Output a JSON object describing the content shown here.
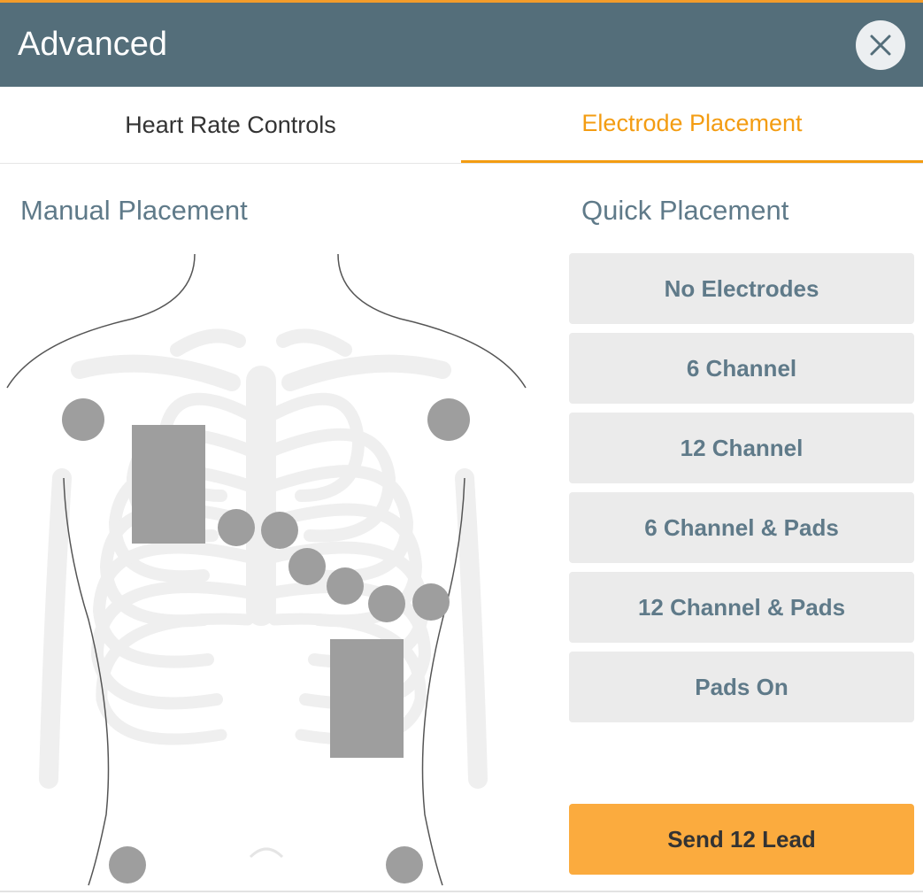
{
  "header": {
    "title": "Advanced",
    "close_icon": "close-icon"
  },
  "tabs": [
    {
      "label": "Heart Rate Controls",
      "active": false
    },
    {
      "label": "Electrode Placement",
      "active": true
    }
  ],
  "manual_placement": {
    "title": "Manual Placement"
  },
  "quick_placement": {
    "title": "Quick Placement",
    "options": [
      {
        "label": "No Electrodes"
      },
      {
        "label": "6 Channel"
      },
      {
        "label": "12 Channel"
      },
      {
        "label": "6 Channel & Pads"
      },
      {
        "label": "12 Channel & Pads"
      },
      {
        "label": "Pads On"
      }
    ]
  },
  "send_button": {
    "label": "Send 12 Lead"
  },
  "colors": {
    "header": "#546e7a",
    "accent": "#f39c12",
    "send": "#fbab3e",
    "electrode": "#9e9e9e",
    "section_title": "#5f7a89"
  }
}
